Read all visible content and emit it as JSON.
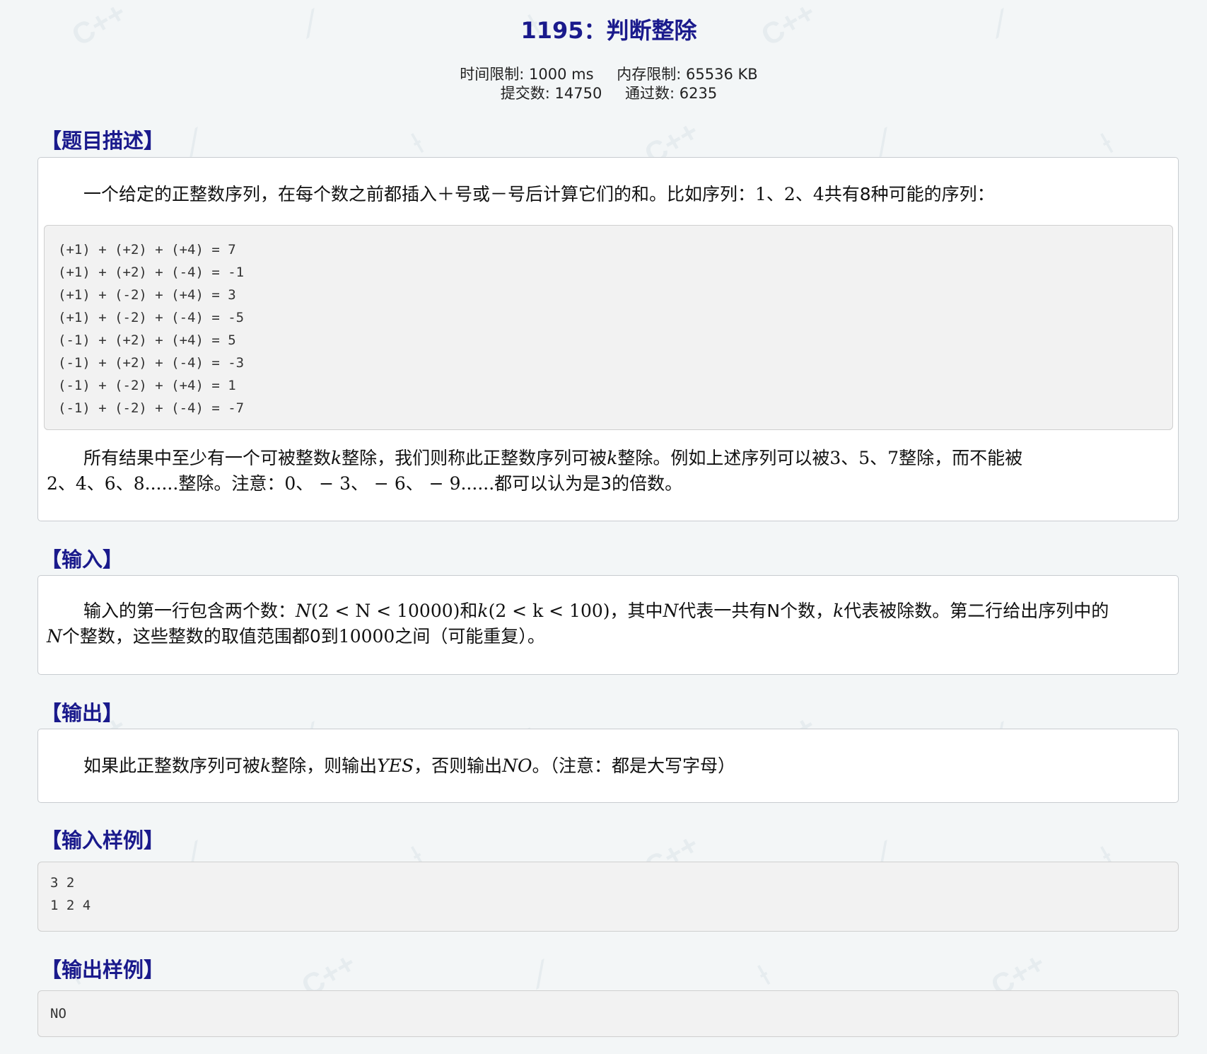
{
  "problem": {
    "title": "1195：判断整除",
    "limits": {
      "time": "时间限制: 1000 ms",
      "memory": "内存限制: 65536 KB",
      "submissions": "提交数: 14750",
      "accepted": "通过数: 6235"
    }
  },
  "description": {
    "heading": "【题目描述】",
    "intro_a": "一个给定的正整数序列，在每个数之前都插入＋号或－号后计算它们的和。比如序列：",
    "intro_seq": "1、2、4",
    "intro_b": "共有8种可能的序列：",
    "sequences": [
      "(+1) + (+2) + (+4) = 7",
      "(+1) + (+2) + (-4) = -1",
      "(+1) + (-2) + (+4) = 3",
      "(+1) + (-2) + (-4) = -5",
      "(-1) + (+2) + (+4) = 5",
      "(-1) + (+2) + (-4) = -3",
      "(-1) + (-2) + (+4) = 1",
      "(-1) + (-2) + (-4) = -7"
    ],
    "result_a": "所有结果中至少有一个可被整数",
    "var_k": "k",
    "result_b": "整除，我们则称此正整数序列可被",
    "result_c": "整除。例如上述序列可以被",
    "divisors": "3、5、7",
    "result_d": "整除，而不能被",
    "non_divisors": "2、4、6、8......",
    "result_e": "整除。注意：",
    "multiples": "0、 − 3、 − 6、 − 9......",
    "result_f": "都可以认为是3的倍数。"
  },
  "input": {
    "heading": "【输入】",
    "a": "输入的第一行包含两个数：",
    "var_N": "N",
    "range_N": "(2 < N < 10000)",
    "b": "和",
    "range_k": "(2 < k < 100)",
    "c": "，其中",
    "d": "代表一共有N个数，",
    "e": "代表被除数。第二行给出序列中的",
    "f": "个整数，这些整数的取值范围都0到",
    "num_10000": "10000",
    "g": "之间（可能重复）。"
  },
  "output": {
    "heading": "【输出】",
    "a": "如果此正整数序列可被",
    "b": "整除，则输出",
    "yes": "YES",
    "c": "，否则输出",
    "no": "NO",
    "d": "。（注意：都是大写字母）"
  },
  "sample_input": {
    "heading": "【输入样例】",
    "lines": [
      "3 2",
      "1 2 4"
    ]
  },
  "sample_output": {
    "heading": "【输出样例】",
    "lines": [
      "NO"
    ]
  }
}
